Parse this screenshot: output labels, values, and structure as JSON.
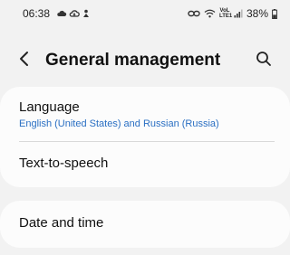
{
  "status_bar": {
    "time": "06:38",
    "left_icons": [
      "cloud-icon",
      "cloud-sync-icon",
      "notification-person-icon"
    ],
    "right_icons": [
      "link-icon",
      "wifi-icon",
      "volte-icon",
      "signal-icon"
    ],
    "volte_label_top": "VoL",
    "volte_label_bottom": "LTE1",
    "battery": "38%"
  },
  "header": {
    "title": "General management"
  },
  "settings": {
    "card1": {
      "language": {
        "title": "Language",
        "subtitle": "English (United States) and Russian (Russia)"
      },
      "tts": {
        "title": "Text-to-speech"
      }
    },
    "card2": {
      "datetime": {
        "title": "Date and time"
      }
    }
  },
  "colors": {
    "background": "#f2f2f2",
    "card": "#fcfcfc",
    "subtitle_blue": "#2a6fc3"
  }
}
